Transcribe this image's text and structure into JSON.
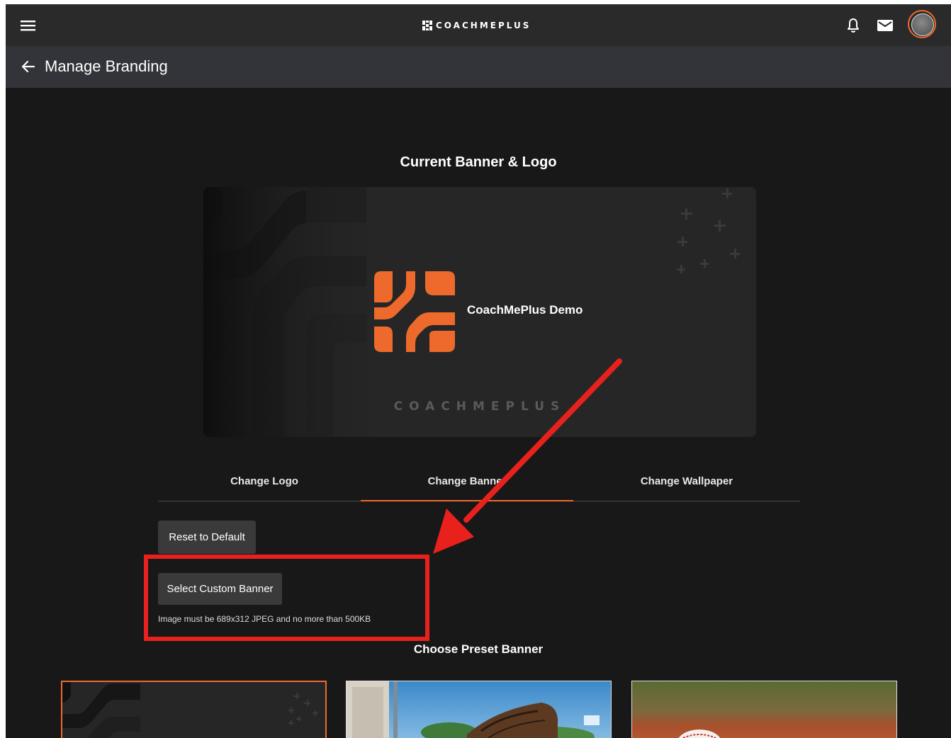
{
  "header": {
    "brand": "COACHMEPLUS",
    "menu_icon": "menu-icon",
    "notification_icon": "bell-icon",
    "mail_icon": "mail-icon"
  },
  "subheader": {
    "title": "Manage Branding",
    "back_icon": "arrow-left-icon"
  },
  "current": {
    "title": "Current Banner & Logo",
    "org_name": "CoachMePlus Demo",
    "watermark": "COACHMEPLUS"
  },
  "tabs": [
    {
      "label": "Change Logo",
      "active": false
    },
    {
      "label": "Change Banner",
      "active": true
    },
    {
      "label": "Change Wallpaper",
      "active": false
    }
  ],
  "actions": {
    "reset_label": "Reset to Default",
    "select_label": "Select Custom Banner",
    "help_text": "Image must be 689x312 JPEG and no more than 500KB"
  },
  "presets": {
    "title": "Choose Preset Banner",
    "items": [
      "default-dark-banner",
      "baseball-glove-banner",
      "baseball-field-banner"
    ]
  },
  "colors": {
    "accent": "#ee6a2c",
    "annotation": "#e8211c",
    "background": "#181818",
    "topbar": "#2a2a2a",
    "subbar": "#33343a"
  }
}
